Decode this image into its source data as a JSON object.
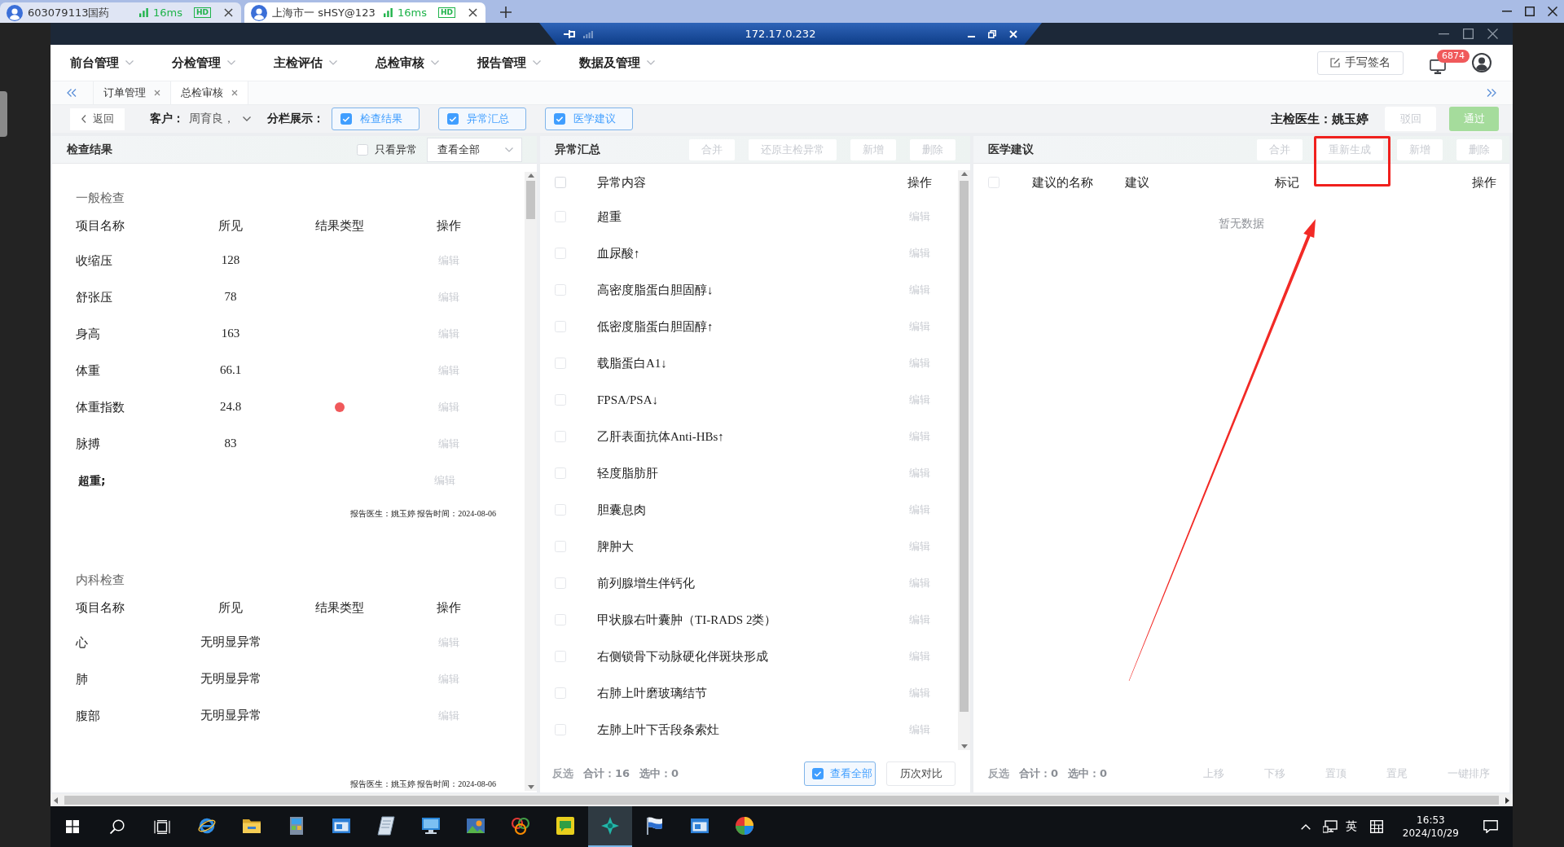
{
  "browser": {
    "tabs": [
      {
        "title": "603079113国药",
        "latency": "16ms",
        "quality": "HD",
        "selected": false
      },
      {
        "title": "上海市一 sHSY@123",
        "latency": "16ms",
        "quality": "HD",
        "selected": true
      }
    ]
  },
  "remote_bar": {
    "address": "172.17.0.232"
  },
  "menu": [
    {
      "label": "前台管理"
    },
    {
      "label": "分检管理"
    },
    {
      "label": "主检评估"
    },
    {
      "label": "总检审核"
    },
    {
      "label": "报告管理"
    },
    {
      "label": "数据及管理"
    }
  ],
  "header_actions": {
    "sign": "手写签名",
    "notifications": "6874"
  },
  "page_tabs": [
    {
      "label": "订单管理",
      "selected": false
    },
    {
      "label": "总检审核",
      "selected": true
    }
  ],
  "toolbar": {
    "back": "返回",
    "customer_label": "客户：",
    "customer": "周育良，",
    "columns_label": "分栏展示：",
    "column_toggles": [
      {
        "label": "检查结果",
        "checked": true
      },
      {
        "label": "异常汇总",
        "checked": true
      },
      {
        "label": "医学建议",
        "checked": true
      }
    ],
    "doctor_label": "主检医生：",
    "doctor": "姚玉婷",
    "actions": [
      {
        "label": "驳回",
        "kind": "default",
        "disabled": true
      },
      {
        "label": "通过",
        "kind": "success",
        "disabled": true
      }
    ]
  },
  "exam_results": {
    "title": "检查结果",
    "only_abnormal": {
      "label": "只看异常",
      "checked": false
    },
    "filter": "查看全部",
    "sections": [
      {
        "title": "一般检查",
        "columns": [
          "项目名称",
          "所见",
          "结果类型",
          "操作"
        ],
        "rows": [
          {
            "name": "收缩压",
            "finding": "128",
            "flagged": false,
            "action": "编辑"
          },
          {
            "name": "舒张压",
            "finding": "78",
            "flagged": false,
            "action": "编辑"
          },
          {
            "name": "身高",
            "finding": "163",
            "flagged": false,
            "action": "编辑"
          },
          {
            "name": "体重",
            "finding": "66.1",
            "flagged": false,
            "action": "编辑"
          },
          {
            "name": "体重指数",
            "finding": "24.8",
            "flagged": true,
            "action": "编辑"
          },
          {
            "name": "脉搏",
            "finding": "83",
            "flagged": false,
            "action": "编辑"
          }
        ],
        "summary": {
          "text": "超重;",
          "action": "编辑"
        },
        "footer": "报告医生：姚玉婷 报告时间：2024-08-06"
      },
      {
        "title": "内科检查",
        "columns": [
          "项目名称",
          "所见",
          "结果类型",
          "操作"
        ],
        "rows": [
          {
            "name": "心",
            "finding": "无明显异常",
            "flagged": false,
            "action": "编辑"
          },
          {
            "name": "肺",
            "finding": "无明显异常",
            "flagged": false,
            "action": "编辑"
          },
          {
            "name": "腹部",
            "finding": "无明显异常",
            "flagged": false,
            "action": "编辑"
          }
        ],
        "footer": "报告医生：姚玉婷 报告时间：2024-08-06"
      }
    ]
  },
  "abnormal_summary": {
    "title": "异常汇总",
    "buttons": [
      {
        "label": "合并",
        "disabled": true
      },
      {
        "label": "还原主检异常",
        "disabled": true
      },
      {
        "label": "新增",
        "disabled": true
      },
      {
        "label": "删除",
        "disabled": true
      }
    ],
    "select_all": false,
    "columns": [
      "异常内容",
      "操作"
    ],
    "rows": [
      {
        "text": "超重",
        "checked": false,
        "action": "编辑"
      },
      {
        "text": "血尿酸↑",
        "checked": false,
        "action": "编辑"
      },
      {
        "text": "高密度脂蛋白胆固醇↓",
        "checked": false,
        "action": "编辑"
      },
      {
        "text": "低密度脂蛋白胆固醇↑",
        "checked": false,
        "action": "编辑"
      },
      {
        "text": "载脂蛋白A1↓",
        "checked": false,
        "action": "编辑"
      },
      {
        "text": "FPSA/PSA↓",
        "checked": false,
        "action": "编辑"
      },
      {
        "text": "乙肝表面抗体Anti-HBs↑",
        "checked": false,
        "action": "编辑"
      },
      {
        "text": "轻度脂肪肝",
        "checked": false,
        "action": "编辑"
      },
      {
        "text": "胆囊息肉",
        "checked": false,
        "action": "编辑"
      },
      {
        "text": "脾肿大",
        "checked": false,
        "action": "编辑"
      },
      {
        "text": "前列腺增生伴钙化",
        "checked": false,
        "action": "编辑"
      },
      {
        "text": "甲状腺右叶囊肿（TI-RADS 2类）",
        "checked": false,
        "action": "编辑"
      },
      {
        "text": "右侧锁骨下动脉硬化伴斑块形成",
        "checked": false,
        "action": "编辑"
      },
      {
        "text": "右肺上叶磨玻璃结节",
        "checked": false,
        "action": "编辑"
      },
      {
        "text": "左肺上叶下舌段条索灶",
        "checked": false,
        "action": "编辑"
      }
    ],
    "footer": {
      "invert": "反选",
      "total": "合计：16",
      "selected": "选中：0",
      "view_all": {
        "label": "查看全部",
        "checked": true
      },
      "compare": "历次对比"
    }
  },
  "medical_advice": {
    "title": "医学建议",
    "buttons": [
      {
        "label": "合并",
        "disabled": true
      },
      {
        "label": "重新生成",
        "disabled": true
      },
      {
        "label": "新增",
        "disabled": true
      },
      {
        "label": "删除",
        "disabled": true
      }
    ],
    "select_all": false,
    "columns": [
      "建议的名称",
      "建议",
      "标记",
      "操作"
    ],
    "empty_text": "暂无数据",
    "footer": {
      "invert": "反选",
      "total": "合计：0",
      "selected": "选中：0",
      "buttons": [
        {
          "label": "上移",
          "disabled": true
        },
        {
          "label": "下移",
          "disabled": true
        },
        {
          "label": "置顶",
          "disabled": true
        },
        {
          "label": "置尾",
          "disabled": true
        },
        {
          "label": "一键排序",
          "disabled": true
        }
      ]
    }
  },
  "annotations": [
    {
      "kind": "frame"
    },
    {
      "kind": "arrow"
    }
  ],
  "taskbar": {
    "apps": [
      {
        "kind": "browser",
        "selected": false
      },
      {
        "kind": "folder",
        "selected": false
      },
      {
        "kind": "server",
        "selected": false
      },
      {
        "kind": "window",
        "selected": false
      },
      {
        "kind": "notepad",
        "selected": false
      },
      {
        "kind": "monitor",
        "selected": false
      },
      {
        "kind": "media",
        "selected": false
      },
      {
        "kind": "rings",
        "selected": false
      },
      {
        "kind": "chat",
        "selected": false
      },
      {
        "kind": "remote",
        "selected": true
      },
      {
        "kind": "flag",
        "selected": false
      },
      {
        "kind": "window",
        "selected": false
      },
      {
        "kind": "ball",
        "selected": false
      }
    ],
    "ime": "英",
    "time": "16:53",
    "date": "2024/10/29"
  }
}
